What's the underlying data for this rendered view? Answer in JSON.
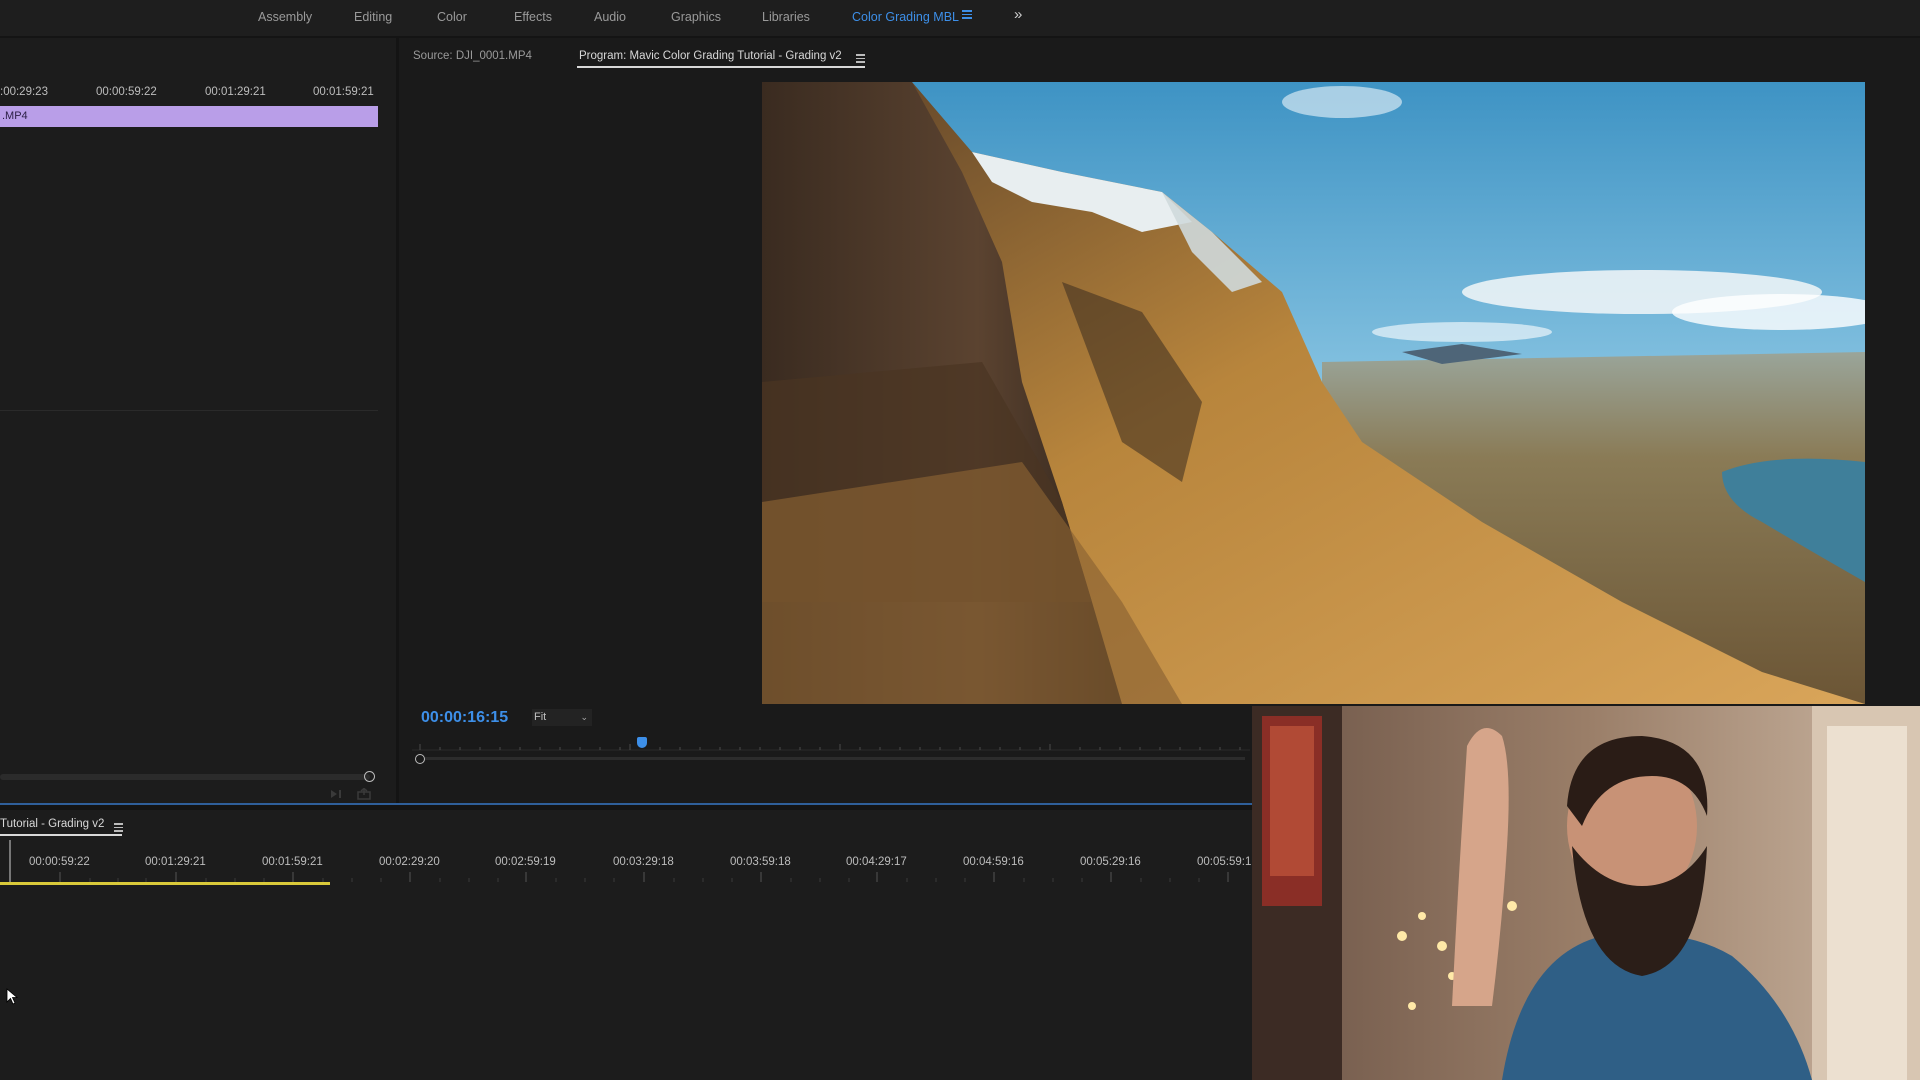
{
  "workspaces": [
    {
      "label": "Assembly",
      "active": false
    },
    {
      "label": "Editing",
      "active": false
    },
    {
      "label": "Color",
      "active": false
    },
    {
      "label": "Effects",
      "active": false
    },
    {
      "label": "Audio",
      "active": false
    },
    {
      "label": "Graphics",
      "active": false
    },
    {
      "label": "Libraries",
      "active": false
    },
    {
      "label": "Color Grading MBL",
      "active": true
    }
  ],
  "workspace_overflow_icon": "chevron-double-right-icon",
  "accent_color": "#3d8fe8",
  "source_monitor": {
    "tab_label": "Source: DJI_0001.MP4",
    "ruler_timecodes": [
      ":00:29:23",
      "00:00:59:22",
      "00:01:29:21",
      "00:01:59:21"
    ],
    "clip_label": ".MP4",
    "clip_color": "#b99ee8"
  },
  "program_monitor": {
    "tab_label": "Program: Mavic Color Grading Tutorial - Grading v2",
    "timecode": "00:00:16:15",
    "zoom_option": "Fit"
  },
  "timeline": {
    "sequence_tab": "Tutorial - Grading v2",
    "ruler_timecodes": [
      "00:00:59:22",
      "00:01:29:21",
      "00:01:59:21",
      "00:02:29:20",
      "00:02:59:19",
      "00:03:29:18",
      "00:03:59:18",
      "00:04:29:17",
      "00:04:59:16",
      "00:05:29:16",
      "00:05:59:1"
    ],
    "work_area_color": "#d9c93a"
  }
}
